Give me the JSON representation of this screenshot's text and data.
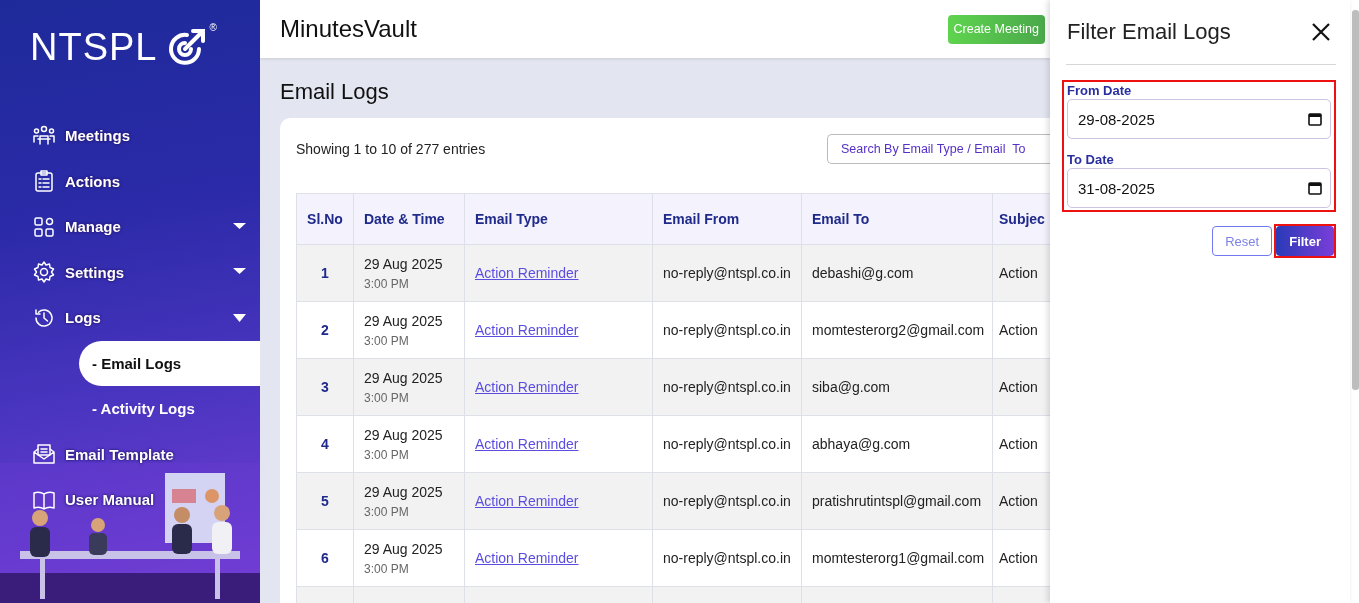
{
  "sidebar": {
    "logo": {
      "text": "NTSPL",
      "mark": "®"
    },
    "items": [
      {
        "label": "Meetings"
      },
      {
        "label": "Actions"
      },
      {
        "label": "Manage",
        "expanded": false
      },
      {
        "label": "Settings",
        "expanded": false
      },
      {
        "label": "Logs",
        "expanded": true,
        "children": [
          {
            "label": "- Email Logs",
            "selected": true
          },
          {
            "label": "- Activity Logs",
            "selected": false
          }
        ]
      },
      {
        "label": "Email Template"
      },
      {
        "label": "User Manual"
      }
    ]
  },
  "header": {
    "app_title": "MinutesVault",
    "create_button": "Create Meeting"
  },
  "page": {
    "title": "Email Logs",
    "entries_info": "Showing 1 to 10 of 277 entries",
    "search": {
      "placeholder": "Search By Email Type / Email  To"
    }
  },
  "table": {
    "columns": [
      "Sl.No",
      "Date & Time",
      "Email Type",
      "Email From",
      "Email To",
      "Subjec"
    ],
    "rows": [
      {
        "sl": "1",
        "date": "29 Aug 2025",
        "time": "3:00 PM",
        "type": "Action Reminder",
        "from": "no-reply@ntspl.co.in",
        "to": "debashi@g.com",
        "subject": "Action"
      },
      {
        "sl": "2",
        "date": "29 Aug 2025",
        "time": "3:00 PM",
        "type": "Action Reminder",
        "from": "no-reply@ntspl.co.in",
        "to": "momtesterorg2@gmail.com",
        "subject": "Action"
      },
      {
        "sl": "3",
        "date": "29 Aug 2025",
        "time": "3:00 PM",
        "type": "Action Reminder",
        "from": "no-reply@ntspl.co.in",
        "to": "siba@g.com",
        "subject": "Action"
      },
      {
        "sl": "4",
        "date": "29 Aug 2025",
        "time": "3:00 PM",
        "type": "Action Reminder",
        "from": "no-reply@ntspl.co.in",
        "to": "abhaya@g.com",
        "subject": "Action"
      },
      {
        "sl": "5",
        "date": "29 Aug 2025",
        "time": "3:00 PM",
        "type": "Action Reminder",
        "from": "no-reply@ntspl.co.in",
        "to": "pratishrutintspl@gmail.com",
        "subject": "Action"
      },
      {
        "sl": "6",
        "date": "29 Aug 2025",
        "time": "3:00 PM",
        "type": "Action Reminder",
        "from": "no-reply@ntspl.co.in",
        "to": "momtesterorg1@gmail.com",
        "subject": "Action"
      }
    ]
  },
  "filter_panel": {
    "title": "Filter Email Logs",
    "date_group_highlighted": true,
    "fields": [
      {
        "label": "From Date",
        "value": "29-08-2025"
      },
      {
        "label": "To Date",
        "value": "31-08-2025"
      }
    ],
    "reset_button": "Reset",
    "filter_button": {
      "label": "Filter",
      "highlighted": true
    }
  }
}
